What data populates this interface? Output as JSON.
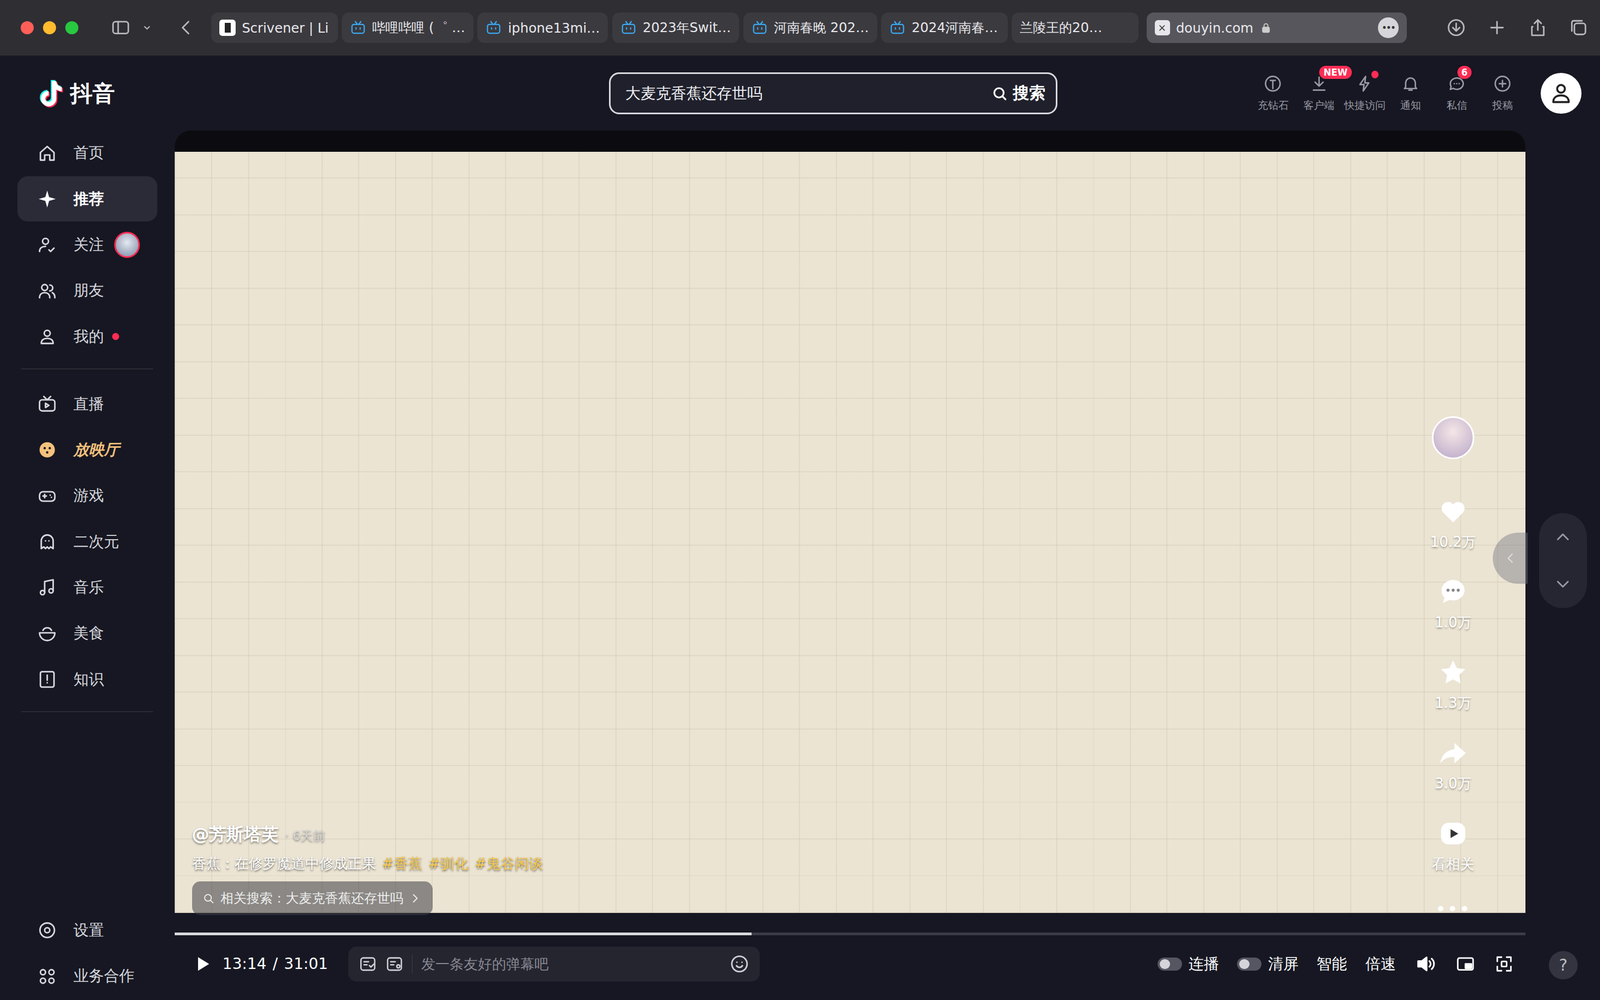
{
  "browser": {
    "tabs": [
      {
        "label": "Scrivener | Li",
        "kind": "scrivener",
        "selected": false
      },
      {
        "label": "哔哩哔哩 (゜ …",
        "kind": "bilibili",
        "selected": false
      },
      {
        "label": "iphone13mi…",
        "kind": "bilibili",
        "selected": false
      },
      {
        "label": "2023年Swit…",
        "kind": "bilibili",
        "selected": false
      },
      {
        "label": "河南春晚 202…",
        "kind": "bilibili",
        "selected": false
      },
      {
        "label": "2024河南春…",
        "kind": "bilibili",
        "selected": false
      },
      {
        "label": "兰陵王的20…",
        "kind": "plain",
        "selected": false
      },
      {
        "label": "douyin.com",
        "kind": "address",
        "selected": true
      }
    ],
    "more": "•••"
  },
  "header": {
    "logo": "抖音",
    "search": {
      "value": "大麦克香蕉还存世吗",
      "button": "搜索"
    },
    "actions": [
      {
        "label": "充钻石",
        "dot": false
      },
      {
        "label": "客户端",
        "badge": "NEW",
        "dot": false
      },
      {
        "label": "快捷访问",
        "dot": true
      },
      {
        "label": "通知",
        "dot": false
      },
      {
        "label": "私信",
        "badge": "6",
        "dot": false
      },
      {
        "label": "投稿",
        "dot": false
      }
    ]
  },
  "sidebar": {
    "main": [
      {
        "label": "首页",
        "selected": false,
        "dot": false,
        "avatar": false
      },
      {
        "label": "推荐",
        "selected": true,
        "dot": false,
        "avatar": false
      },
      {
        "label": "关注",
        "selected": false,
        "dot": false,
        "avatar": true
      },
      {
        "label": "朋友",
        "selected": false,
        "dot": false,
        "avatar": false
      },
      {
        "label": "我的",
        "selected": false,
        "dot": true,
        "avatar": false
      }
    ],
    "channels": [
      {
        "label": "直播",
        "kind": "normal",
        "selected": false
      },
      {
        "label": "放映厅",
        "kind": "feature",
        "selected": false
      },
      {
        "label": "游戏",
        "kind": "normal",
        "selected": false
      },
      {
        "label": "二次元",
        "kind": "normal",
        "selected": false
      },
      {
        "label": "音乐",
        "kind": "normal",
        "selected": false
      },
      {
        "label": "美食",
        "kind": "normal",
        "selected": false
      },
      {
        "label": "知识",
        "kind": "normal",
        "selected": false
      }
    ],
    "bottom": [
      {
        "label": "设置"
      },
      {
        "label": "业务合作"
      }
    ]
  },
  "video": {
    "author": "@芳斯塔芙",
    "time": "· 6天前",
    "description": "香蕉：在修罗魔道中修成正果",
    "tags": [
      "#香蕉",
      "#驯化",
      "#鬼谷闲谈"
    ],
    "related": "相关搜索：大麦克香蕉还存世吗",
    "actions": [
      {
        "label": "10.2万"
      },
      {
        "label": "1.0万"
      },
      {
        "label": "1.3万"
      },
      {
        "label": "3.0万"
      },
      {
        "label": "看相关"
      }
    ],
    "more": "•••",
    "progress": {
      "level": 0.427,
      "current": "13:14",
      "separator": "/",
      "total": "31:01"
    },
    "danmaku_placeholder": "发一条友好的弹幕吧",
    "toggles": [
      {
        "label": "连播",
        "on": false
      },
      {
        "label": "清屏",
        "on": false
      }
    ],
    "buttons": [
      "智能",
      "倍速"
    ]
  },
  "help": "?"
}
